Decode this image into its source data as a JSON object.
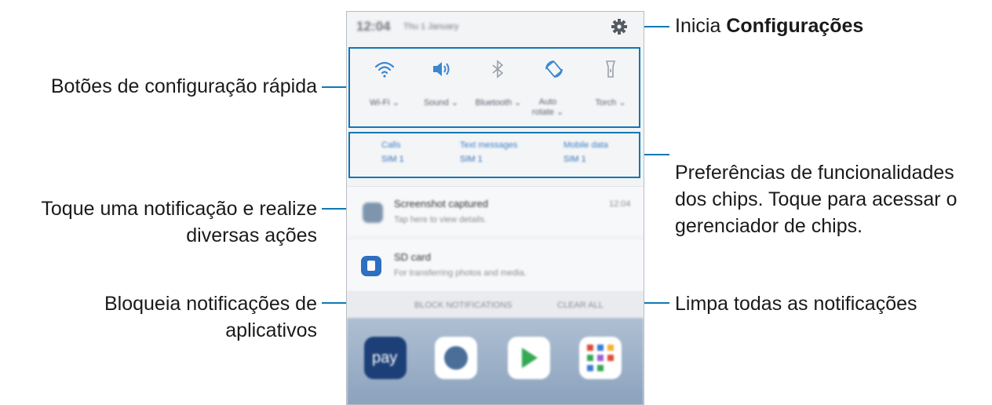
{
  "callouts": {
    "settings_prefix": "Inicia ",
    "settings_bold": "Configurações",
    "quick_buttons": "Botões de configuração rápida",
    "chip_prefs_l1": "Preferências de funcionalidades",
    "chip_prefs_l2": "dos chips. Toque para acessar o",
    "chip_prefs_l3": "gerenciador de chips.",
    "tap_notification_l1": "Toque uma notificação e realize",
    "tap_notification_l2": "diversas ações",
    "block_l1": "Bloqueia notificações de",
    "block_l2": "aplicativos",
    "clear_all": "Limpa todas as notificações"
  },
  "phone": {
    "status": {
      "time": "12:04",
      "date": "Thu 1 January"
    },
    "quick_settings": [
      {
        "icon": "wifi-icon",
        "label": "Wi-Fi ⌄"
      },
      {
        "icon": "sound-icon",
        "label": "Sound ⌄"
      },
      {
        "icon": "bluetooth-icon",
        "label": "Bluetooth ⌄"
      },
      {
        "icon": "auto-rotate-icon",
        "label": "Auto rotate ⌄"
      },
      {
        "icon": "torch-icon",
        "label": "Torch ⌄"
      }
    ],
    "chips": [
      {
        "title": "Calls",
        "value": "SIM 1"
      },
      {
        "title": "Text messages",
        "value": "SIM 1"
      },
      {
        "title": "Mobile data",
        "value": "SIM 1"
      }
    ],
    "notifications": [
      {
        "title": "Screenshot captured",
        "sub": "Tap here to view details.",
        "time": "12:04"
      },
      {
        "title": "SD card",
        "sub": "For transferring photos and media."
      }
    ],
    "block_label": "BLOCK NOTIFICATIONS",
    "clear_label": "CLEAR ALL",
    "home_pay": "pay"
  },
  "colors": {
    "accent": "#0f78b4"
  }
}
